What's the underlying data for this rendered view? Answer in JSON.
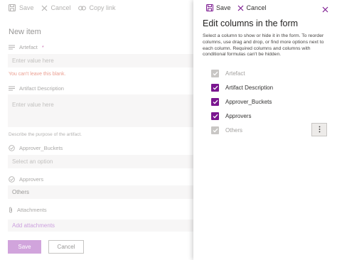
{
  "form": {
    "toolbar": {
      "save": "Save",
      "cancel": "Cancel",
      "copy_link": "Copy link"
    },
    "title": "New item",
    "fields": {
      "artefact": {
        "label": "Artefact",
        "required_mark": "*",
        "placeholder": "Enter value here",
        "error": "You can't leave this blank."
      },
      "artifact_description": {
        "label": "Artifact Description",
        "placeholder": "Enter value here",
        "help": "Describe the purpose of the artifact."
      },
      "approver_buckets": {
        "label": "Approver_Buckets",
        "placeholder": "Select an option"
      },
      "approvers": {
        "label": "Approvers",
        "value": "Others"
      },
      "attachments": {
        "label": "Attachments",
        "add_label": "Add attachments"
      }
    },
    "buttons": {
      "save": "Save",
      "cancel": "Cancel"
    }
  },
  "panel": {
    "toolbar": {
      "save": "Save",
      "cancel": "Cancel"
    },
    "title": "Edit columns in the form",
    "description": "Select a column to show or hide it in the form. To reorder columns, use drag and drop, or find more options next to each column. Required columns and columns with conditional formulas can't be hidden.",
    "columns": [
      {
        "label": "Artefact",
        "checked": true,
        "disabled": true
      },
      {
        "label": "Artifact Description",
        "checked": true,
        "disabled": false
      },
      {
        "label": "Approver_Buckets",
        "checked": true,
        "disabled": false
      },
      {
        "label": "Approvers",
        "checked": true,
        "disabled": false
      },
      {
        "label": "Others",
        "checked": true,
        "disabled": true
      }
    ]
  },
  "colors": {
    "accent": "#7a168f",
    "primary_button": "#b873c9",
    "error": "#e06a55"
  },
  "icons": [
    "save-icon",
    "cancel-icon",
    "copy-link-icon",
    "close-icon",
    "more-options-icon",
    "text-field-icon",
    "choice-field-icon",
    "attachment-icon",
    "checkmark-icon"
  ]
}
